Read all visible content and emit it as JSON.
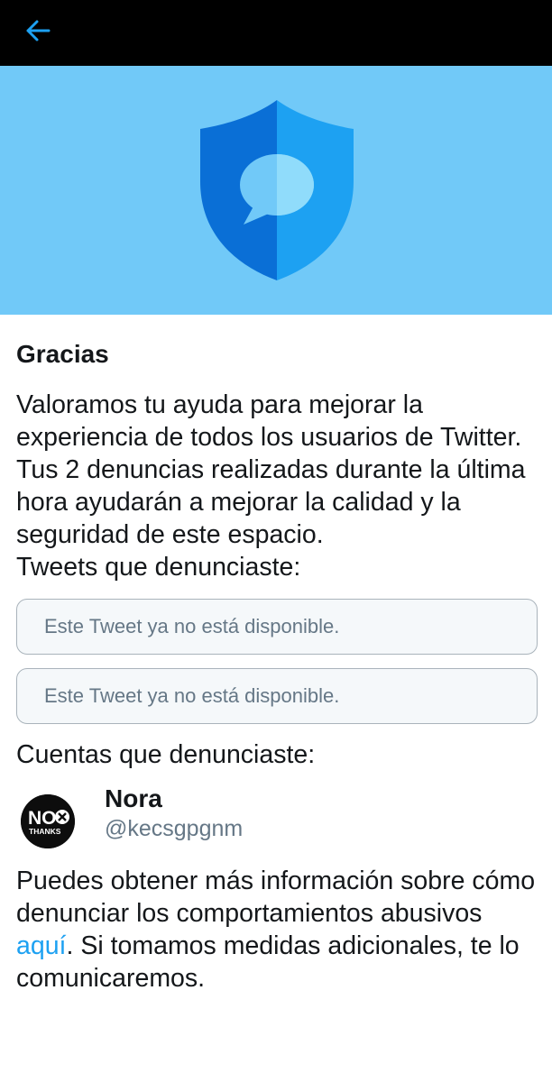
{
  "header": {
    "back_icon": "arrow-left-icon",
    "accent": "#1da1f2",
    "background": "#000000"
  },
  "hero": {
    "background": "#71c9f8",
    "icon": "shield-message-icon"
  },
  "content": {
    "title": "Gracias",
    "message": "Valoramos tu ayuda para mejorar la experiencia de todos los usuarios de Twitter. Tus 2 denuncias realizadas durante la última hora ayudarán a mejorar la calidad y la seguridad de este espacio.",
    "tweets_label": "Tweets que denunciaste:",
    "tweets": [
      {
        "text": "Este Tweet ya no está disponible."
      },
      {
        "text": "Este Tweet ya no está disponible."
      }
    ],
    "accounts_label": "Cuentas que denunciaste:",
    "account": {
      "name": "Nora",
      "handle": "@kecsgpgnm",
      "avatar_text_top": "NO",
      "avatar_text_bottom": "THANKS"
    },
    "footer": {
      "before_link": "Puedes obtener más información sobre cómo denunciar los comportamientos abusivos ",
      "link": "aquí",
      "after_link": ". Si tomamos medidas adicionales, te lo comunicaremos."
    }
  }
}
